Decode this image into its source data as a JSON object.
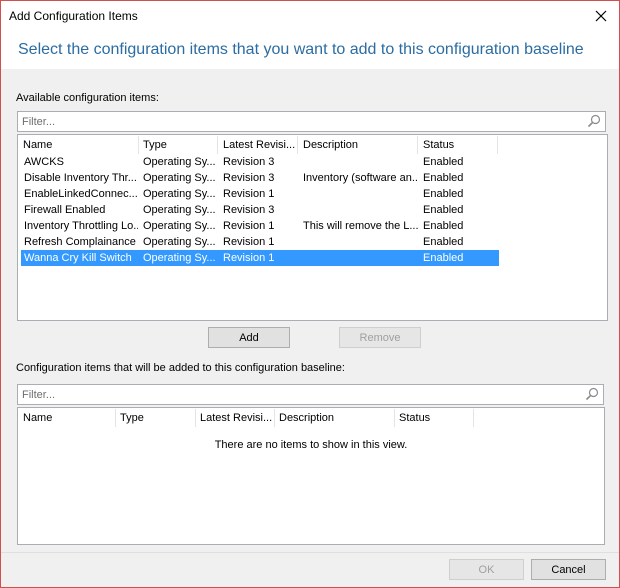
{
  "window": {
    "title": "Add Configuration Items",
    "heading": "Select the configuration items that you want to add to this configuration baseline"
  },
  "available": {
    "label": "Available configuration items:",
    "filter_placeholder": "Filter...",
    "columns": [
      "Name",
      "Type",
      "Latest Revisi...",
      "Description",
      "Status"
    ],
    "rows": [
      {
        "name": "AWCKS",
        "type": "Operating Sy...",
        "revision": "Revision 3",
        "description": "",
        "status": "Enabled",
        "selected": false
      },
      {
        "name": "Disable Inventory Thr...",
        "type": "Operating Sy...",
        "revision": "Revision 3",
        "description": "Inventory (software an...",
        "status": "Enabled",
        "selected": false
      },
      {
        "name": "EnableLinkedConnec...",
        "type": "Operating Sy...",
        "revision": "Revision 1",
        "description": "",
        "status": "Enabled",
        "selected": false
      },
      {
        "name": "Firewall Enabled",
        "type": "Operating Sy...",
        "revision": "Revision 3",
        "description": "",
        "status": "Enabled",
        "selected": false
      },
      {
        "name": "Inventory Throttling Lo...",
        "type": "Operating Sy...",
        "revision": "Revision 1",
        "description": "This will remove the L...",
        "status": "Enabled",
        "selected": false
      },
      {
        "name": "Refresh Complainance",
        "type": "Operating Sy...",
        "revision": "Revision 1",
        "description": "",
        "status": "Enabled",
        "selected": false
      },
      {
        "name": "Wanna Cry Kill Switch",
        "type": "Operating Sy...",
        "revision": "Revision 1",
        "description": "",
        "status": "Enabled",
        "selected": true
      }
    ]
  },
  "actions": {
    "add_label": "Add",
    "remove_label": "Remove"
  },
  "selected_items": {
    "label": "Configuration items that will be added to this configuration baseline:",
    "filter_placeholder": "Filter...",
    "columns": [
      "Name",
      "Type",
      "Latest Revisi...",
      "Description",
      "Status"
    ],
    "empty_message": "There are no items to show in this view."
  },
  "footer": {
    "ok_label": "OK",
    "cancel_label": "Cancel"
  },
  "colors": {
    "heading": "#2b6ca3",
    "selection": "#3399ff"
  }
}
